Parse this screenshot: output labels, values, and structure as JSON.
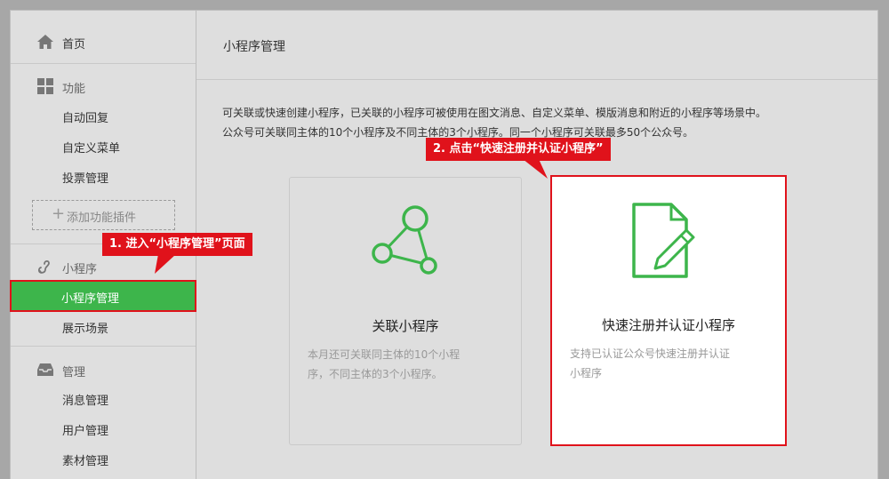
{
  "sidebar": {
    "home": "首页",
    "sections": [
      {
        "title": "功能",
        "icon": "grid-icon",
        "items": [
          "自动回复",
          "自定义菜单",
          "投票管理"
        ]
      },
      {
        "title": "小程序",
        "icon": "link-icon",
        "items": [
          "小程序管理",
          "展示场景"
        ]
      },
      {
        "title": "管理",
        "icon": "inbox-icon",
        "items": [
          "消息管理",
          "用户管理",
          "素材管理"
        ]
      }
    ],
    "add_plugin": "添加功能插件",
    "active_item": "小程序管理"
  },
  "main": {
    "title": "小程序管理",
    "description": [
      "可关联或快速创建小程序，已关联的小程序可被使用在图文消息、自定义菜单、模版消息和附近的小程序等场景中。",
      "公众号可关联同主体的10个小程序及不同主体的3个小程序。同一个小程序可关联最多50个公众号。"
    ],
    "cards": [
      {
        "title": "关联小程序",
        "desc_lines": [
          "本月还可关联同主体的10个小程",
          "序，不同主体的3个小程序。"
        ],
        "icon": "network-link-icon"
      },
      {
        "title": "快速注册并认证小程序",
        "desc_lines": [
          "支持已认证公众号快速注册并认证",
          "小程序"
        ],
        "icon": "document-edit-icon"
      }
    ]
  },
  "annotations": {
    "step1": "1. 进入“小程序管理”页面",
    "step2": "2. 点击“快速注册并认证小程序”"
  },
  "colors": {
    "accent_green": "#3db54b",
    "highlight_red": "#e0121b"
  }
}
